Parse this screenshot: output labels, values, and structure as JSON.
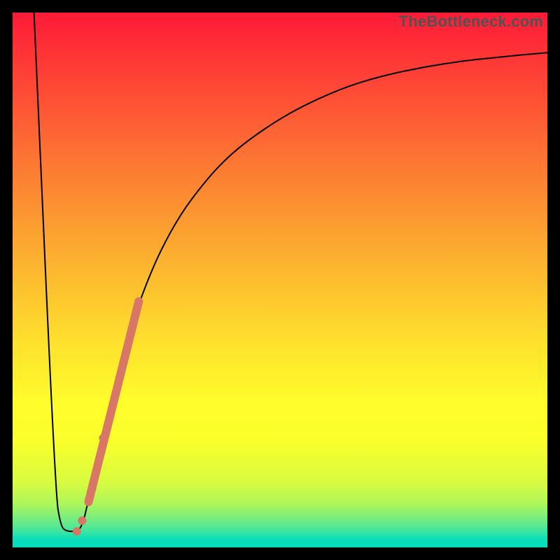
{
  "watermark": "TheBottleneck.com",
  "colors": {
    "frame": "#000000",
    "curve": "#000000",
    "marker": "#d87765",
    "gradient_top": "#fe1a37",
    "gradient_bottom": "#04ddbb"
  },
  "chart_data": {
    "type": "line",
    "title": "",
    "xlabel": "",
    "ylabel": "",
    "xlim": [
      0,
      100
    ],
    "ylim": [
      0,
      100
    ],
    "grid": false,
    "legend": false,
    "description": "Bottleneck curve: steep descent from near top-left to a narrow minimum near x≈10, then rapid rise that asymptotically flattens toward the upper-right.",
    "series": [
      {
        "name": "bottleneck-curve",
        "x": [
          4,
          8,
          9,
          10,
          12,
          13,
          14,
          16,
          19,
          22,
          26,
          30,
          34,
          40,
          48,
          56,
          66,
          80,
          94,
          100
        ],
        "y": [
          100,
          10,
          4,
          3,
          3,
          4,
          8,
          17,
          30,
          41,
          52,
          60,
          66,
          73,
          79,
          83.5,
          87.5,
          90.5,
          92,
          92.5
        ]
      }
    ],
    "markers": {
      "description": "Dense band of salmon circular markers along the lower ascending portion of the curve.",
      "band": {
        "x0": 14.2,
        "y0": 8.5,
        "x1": 23.6,
        "y1": 46,
        "width": 12
      },
      "points": [
        {
          "x": 12.0,
          "y": 3.0,
          "r": 6
        },
        {
          "x": 13.0,
          "y": 5.0,
          "r": 6
        },
        {
          "x": 15.0,
          "y": 11.0,
          "r": 5
        },
        {
          "x": 15.8,
          "y": 15.5,
          "r": 5
        },
        {
          "x": 16.8,
          "y": 20.5,
          "r": 5
        }
      ]
    }
  }
}
